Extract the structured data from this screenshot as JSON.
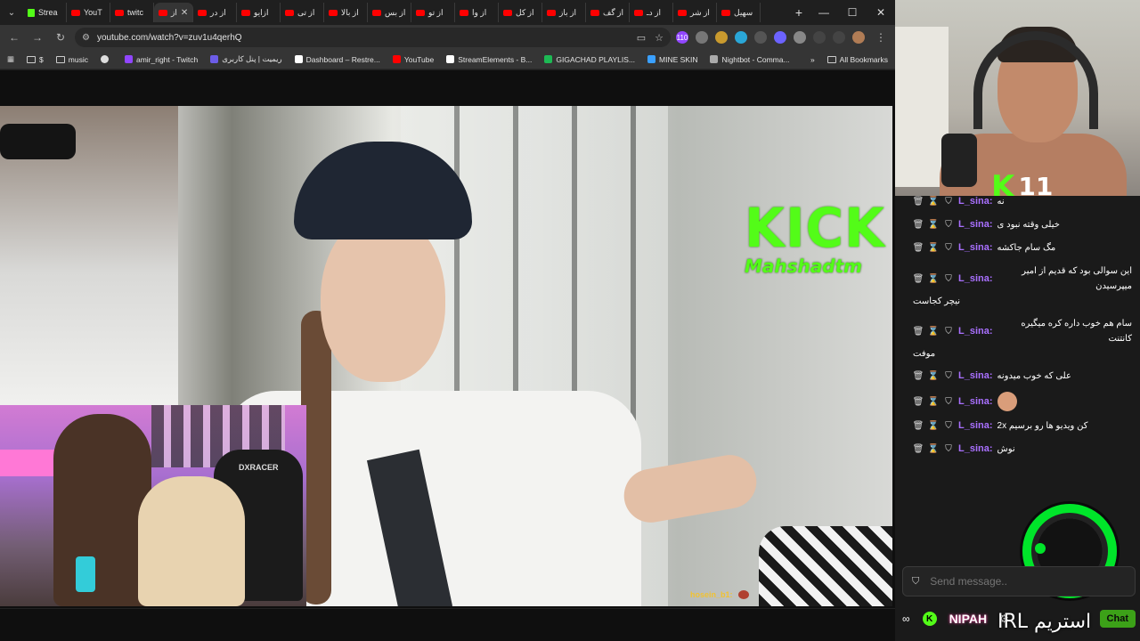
{
  "browser": {
    "tabs": [
      {
        "label": "Strea",
        "icon": "kick"
      },
      {
        "label": "YouT",
        "icon": "youtube"
      },
      {
        "label": "twitc",
        "icon": "youtube"
      },
      {
        "label": "از",
        "icon": "youtube",
        "active": true
      },
      {
        "label": "از در",
        "icon": "youtube"
      },
      {
        "label": "ازایو",
        "icon": "youtube"
      },
      {
        "label": "از تی",
        "icon": "youtube"
      },
      {
        "label": "از بالا",
        "icon": "youtube"
      },
      {
        "label": "از بس",
        "icon": "youtube"
      },
      {
        "label": "از تو",
        "icon": "youtube"
      },
      {
        "label": "از وا",
        "icon": "youtube"
      },
      {
        "label": "از کل",
        "icon": "youtube"
      },
      {
        "label": "از باز",
        "icon": "youtube"
      },
      {
        "label": "از گف",
        "icon": "youtube"
      },
      {
        "label": "از دـ",
        "icon": "youtube"
      },
      {
        "label": "از شر",
        "icon": "youtube"
      },
      {
        "label": "سهیل",
        "icon": "youtube"
      }
    ],
    "url": "youtube.com/watch?v=zuv1u4qerhQ",
    "extension_badge": "110",
    "bookmarks": [
      {
        "label": "$",
        "icon": "folder"
      },
      {
        "label": "music",
        "icon": "folder"
      },
      {
        "label": "",
        "icon": "globe"
      },
      {
        "label": "amir_right - Twitch",
        "icon": "twitch"
      },
      {
        "label": "ریمیت | پنل کاربری",
        "icon": "remit"
      },
      {
        "label": "Dashboard – Restre...",
        "icon": "restream"
      },
      {
        "label": "YouTube",
        "icon": "youtube"
      },
      {
        "label": "StreamElements - B...",
        "icon": "streamelements"
      },
      {
        "label": "GIGACHAD PLAYLIS...",
        "icon": "spotify"
      },
      {
        "label": "MINE SKIN",
        "icon": "mineskin"
      },
      {
        "label": "Nightbot - Comma...",
        "icon": "nightbot"
      }
    ],
    "all_bookmarks": "All Bookmarks"
  },
  "video": {
    "kick_logo": "KICK",
    "kick_channel": "Mahshadtm",
    "chat_overlay_user": "hosein_b1:",
    "inset_chair_brand": "DXRACER"
  },
  "streamer": {
    "overlay_k": "K",
    "overlay_count": "11"
  },
  "chat": {
    "messages": [
      {
        "user": "L_sina:",
        "text": "نه"
      },
      {
        "user": "L_sina:",
        "text": "خیلی وقته نبود ی"
      },
      {
        "user": "L_sina:",
        "text": "مگ سام جاکشه"
      },
      {
        "user": "L_sina:",
        "text": "این سوالی بود که قدیم از امیر میپرسیدن",
        "cont": "نیچر کجاست"
      },
      {
        "user": "L_sina:",
        "text": "سام هم خوب داره کره میگیره کانتنت",
        "cont": "موفت"
      },
      {
        "user": "L_sina:",
        "text": "علی که خوب میدونه"
      },
      {
        "user": "L_sina:",
        "text": "",
        "emote": true
      },
      {
        "user": "L_sina:",
        "text": "کن ویدیو ها رو برسیم 2x"
      },
      {
        "user": "L_sina:",
        "text": "نوش"
      }
    ],
    "input_placeholder": "Send message..",
    "chat_button": "Chat",
    "nipah": "NIPAH",
    "irl_text": "استریم IRL"
  }
}
